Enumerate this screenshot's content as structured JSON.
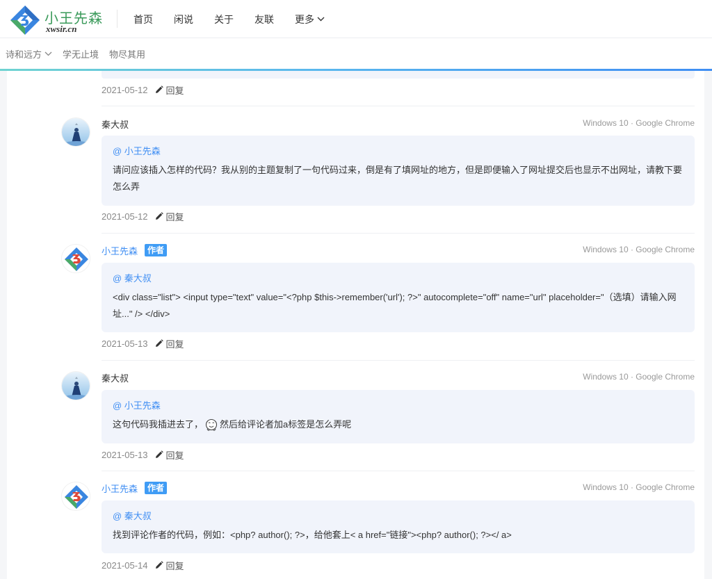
{
  "site": {
    "name": "小王先森",
    "domain": "xwsir.cn"
  },
  "nav": {
    "items": [
      {
        "label": "首页"
      },
      {
        "label": "闲说"
      },
      {
        "label": "关于"
      },
      {
        "label": "友联"
      },
      {
        "label": "更多"
      }
    ]
  },
  "subnav": {
    "items": [
      {
        "label": "诗和远方"
      },
      {
        "label": "学无止境"
      },
      {
        "label": "物尽其用"
      }
    ]
  },
  "reply_label": "回复",
  "author_badge": "作者",
  "top_meta": {
    "date": "2021-05-12"
  },
  "comments": [
    {
      "author": "秦大叔",
      "ua": "Windows 10 · Google Chrome",
      "mention": "@ 小王先森",
      "text": "请问应该插入怎样的代码？我从别的主题复制了一句代码过来，倒是有了填网址的地方，但是即便输入了网址提交后也显示不出网址，请教下要怎么弄",
      "date": "2021-05-12"
    },
    {
      "author": "小王先森",
      "ua": "Windows 10 · Google Chrome",
      "mention": "@ 秦大叔",
      "text": "<div class=\"list\"> <input type=\"text\" value=\"<?php $this->remember('url'); ?>\" autocomplete=\"off\" name=\"url\" placeholder=\"（选填）请输入网址...\" /> </div>",
      "date": "2021-05-13"
    },
    {
      "author": "秦大叔",
      "ua": "Windows 10 · Google Chrome",
      "mention": "@ 小王先森",
      "text_before": "这句代码我插进去了，",
      "text_after": "然后给评论者加a标签是怎么弄呢",
      "date": "2021-05-13"
    },
    {
      "author": "小王先森",
      "ua": "Windows 10 · Google Chrome",
      "mention": "@ 秦大叔",
      "text": "找到评论作者的代码，例如：<php? author(); ?>，给他套上< a href=\"链接\"><php? author(); ?></ a>",
      "date": "2021-05-14"
    }
  ],
  "icons": {
    "logo": "logo-icon",
    "more": "chevron-down-icon",
    "reply": "pencil-icon",
    "emoji": "emoji-icon"
  },
  "colors": {
    "accent": "#3f8ef3",
    "badge": "#3f9cf5",
    "bubble": "#f1f4fb"
  }
}
